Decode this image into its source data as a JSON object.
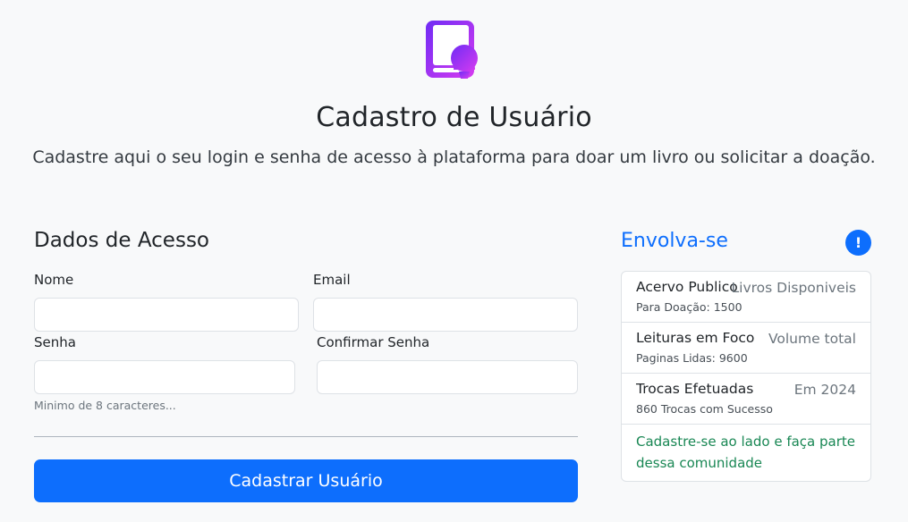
{
  "header": {
    "logo": "book-user-logo-icon",
    "title": "Cadastro de Usuário",
    "subtitle": "Cadastre aqui o seu login e senha de acesso à plataforma para doar um livro ou solicitar a doação."
  },
  "form": {
    "section_title": "Dados de Acesso",
    "name_label": "Nome",
    "name_value": "",
    "email_label": "Email",
    "email_value": "",
    "password_label": "Senha",
    "password_value": "",
    "confirm_label": "Confirmar Senha",
    "confirm_value": "",
    "password_hint": "Minimo de 8 caracteres...",
    "submit_label": "Cadastrar Usuário"
  },
  "aside": {
    "title": "Envolva-se",
    "info_icon": "exclamation-badge-icon",
    "items": [
      {
        "title": "Acervo Publico",
        "right": "Livros Disponiveis",
        "sub": "Para Doação: 1500"
      },
      {
        "title": "Leituras em Foco",
        "right": "Volume total",
        "sub": "Paginas Lidas: 9600"
      },
      {
        "title": "Trocas Efetuadas",
        "right": "Em 2024",
        "sub": "860 Trocas com Sucesso"
      }
    ],
    "footer": "Cadastre-se ao lado e faça parte dessa comunidade"
  },
  "colors": {
    "primary": "#0d6efd",
    "success": "#198754",
    "logo_gradient_start": "#6f2cf5",
    "logo_gradient_end": "#d63bf0",
    "background": "#f8f9fa"
  }
}
